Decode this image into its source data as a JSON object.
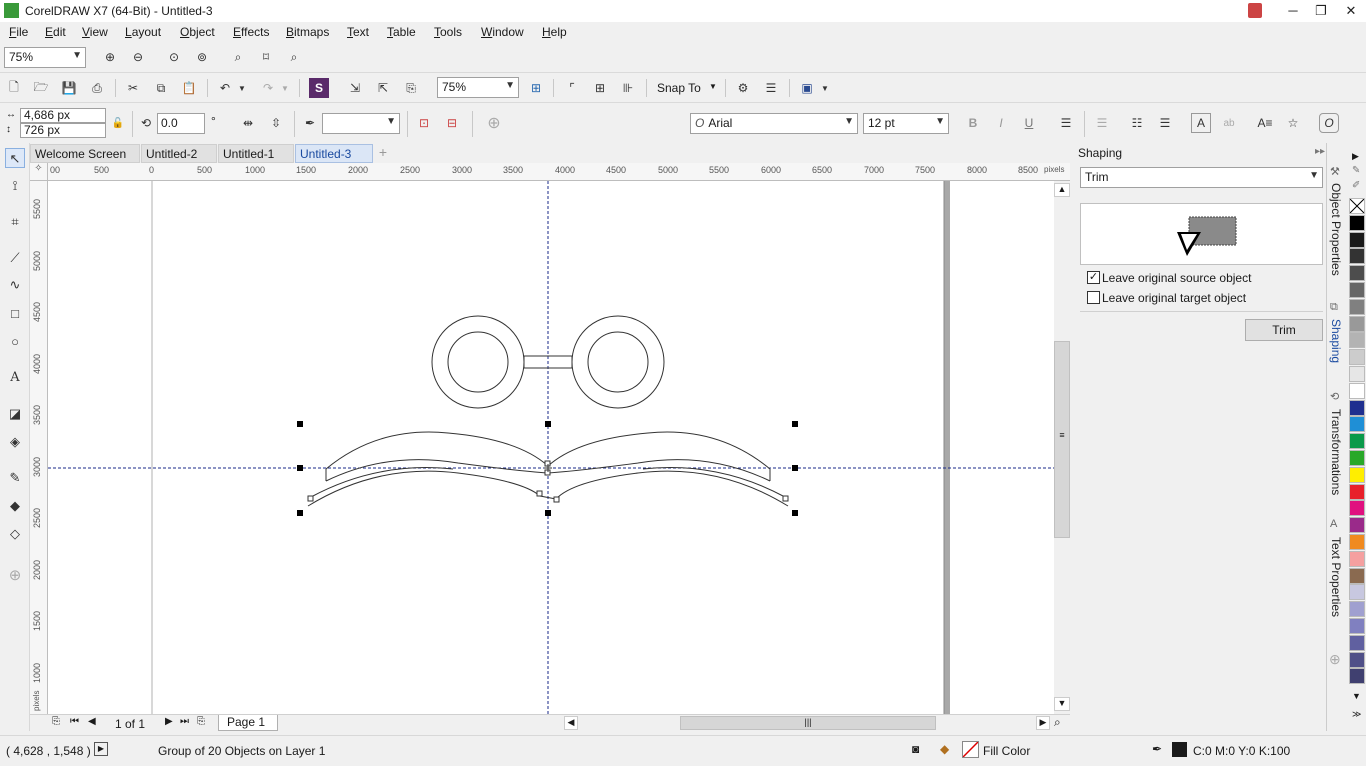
{
  "window": {
    "title": "CorelDRAW X7 (64-Bit) - Untitled-3",
    "minimize_glyph": "─",
    "maximize_glyph": "❐",
    "close_glyph": "✕"
  },
  "menu": [
    {
      "label": "File",
      "underline": "F",
      "rest": "ile"
    },
    {
      "label": "Edit",
      "underline": "E",
      "rest": "dit"
    },
    {
      "label": "View",
      "underline": "V",
      "rest": "iew"
    },
    {
      "label": "Layout",
      "underline": "L",
      "rest": "ayout"
    },
    {
      "label": "Object",
      "underline": "O",
      "rest": "bject"
    },
    {
      "label": "Effects",
      "underline": "E",
      "rest": "ffects"
    },
    {
      "label": "Bitmaps",
      "underline": "B",
      "rest": "itmaps"
    },
    {
      "label": "Text",
      "underline": "T",
      "rest": "ext"
    },
    {
      "label": "Table",
      "underline": "T",
      "rest": "able"
    },
    {
      "label": "Tools",
      "underline": "T",
      "rest": "ools"
    },
    {
      "label": "Window",
      "underline": "W",
      "rest": "indow"
    },
    {
      "label": "Help",
      "underline": "H",
      "rest": "elp"
    }
  ],
  "zoom_toolbar": {
    "zoom_value": "75%"
  },
  "standard_toolbar": {
    "zoom_value": "75%",
    "snap_to_label": "Snap To"
  },
  "property_bar": {
    "width_value": "4,686 px",
    "height_value": "726 px",
    "rotation_value": "0.0",
    "degree_symbol": "°",
    "font_name": "Arial",
    "font_size": "12 pt"
  },
  "doc_tabs": [
    {
      "label": "Welcome Screen",
      "active": false
    },
    {
      "label": "Untitled-2",
      "active": false
    },
    {
      "label": "Untitled-1",
      "active": false
    },
    {
      "label": "Untitled-3",
      "active": true
    }
  ],
  "rulers": {
    "h_ticks": [
      "00",
      "500",
      "0",
      "500",
      "1000",
      "1500",
      "2000",
      "2500",
      "3000",
      "3500",
      "4000",
      "4500",
      "5000",
      "5500",
      "6000",
      "6500",
      "7000",
      "7500",
      "8000",
      "8500"
    ],
    "h_unit": "pixels",
    "v_ticks": [
      "5500",
      "5000",
      "4500",
      "4000",
      "3500",
      "3000",
      "2500",
      "2000",
      "1500",
      "1000"
    ],
    "v_unit": "pixels"
  },
  "page_nav": {
    "page_count_text": "1 of 1",
    "page_tab": "Page 1"
  },
  "shaping_docker": {
    "title": "Shaping",
    "mode": "Trim",
    "leave_source_label": "Leave original source object",
    "leave_source_checked": true,
    "leave_target_label": "Leave original target object",
    "leave_target_checked": false,
    "apply_button": "Trim"
  },
  "docker_tabs": [
    "Object Properties",
    "Shaping",
    "Transformations",
    "Text Properties"
  ],
  "palette_colors": [
    "#ffffff",
    "#000000",
    "#1a1a1a",
    "#333333",
    "#4d4d4d",
    "#666666",
    "#808080",
    "#999999",
    "#b3b3b3",
    "#cccccc",
    "#e6e6e6",
    "#ffffff",
    "#1f2f8f",
    "#1f8fd6",
    "#0a9a4a",
    "#29a829",
    "#ffee00",
    "#e8202a",
    "#e0107f",
    "#9a2a8a",
    "#f08a20",
    "#f5a0a0",
    "#8a6a50",
    "#c8c8e0",
    "#a0a0d0",
    "#8080c0",
    "#6060a0",
    "#505088",
    "#404070"
  ],
  "status": {
    "coords": "( 4,628 , 1,548 )",
    "message": "Group of 20 Objects on Layer 1",
    "fill_label": "Fill Color",
    "outline_label": "C:0 M:0 Y:0 K:100"
  }
}
